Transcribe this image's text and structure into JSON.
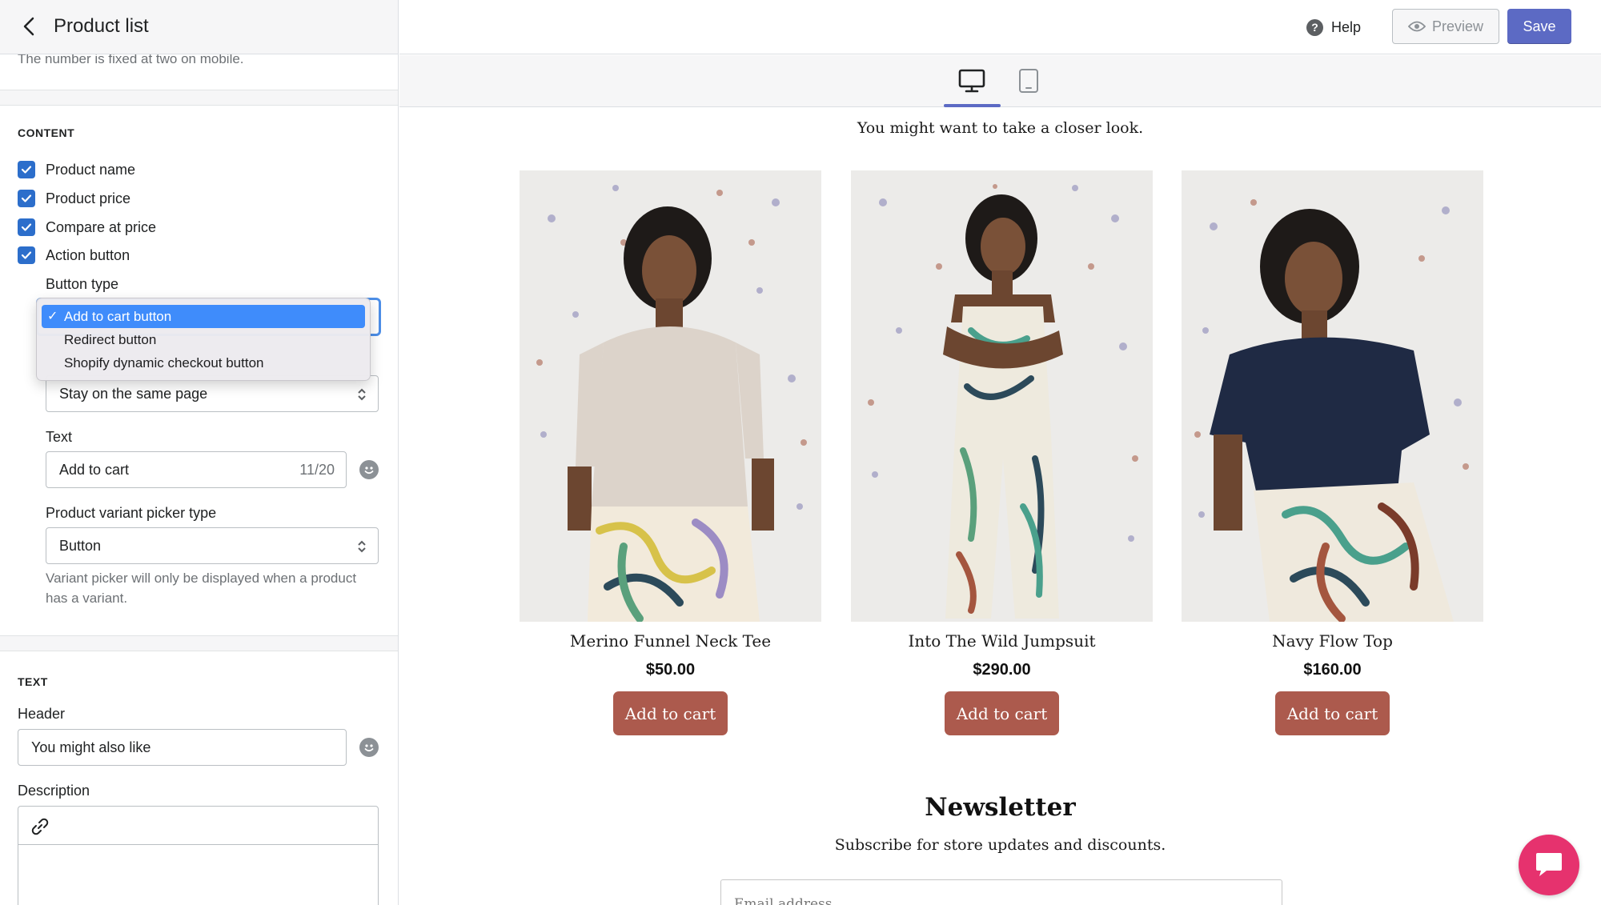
{
  "left_panel": {
    "title": "Product list",
    "top_help": "The number is fixed at two on mobile.",
    "content_section": {
      "title": "CONTENT",
      "checkboxes": [
        {
          "label": "Product name",
          "checked": true
        },
        {
          "label": "Product price",
          "checked": true
        },
        {
          "label": "Compare at price",
          "checked": true
        },
        {
          "label": "Action button",
          "checked": true
        }
      ],
      "button_type_label": "Button type",
      "button_type_options": [
        {
          "label": "Add to cart button",
          "selected": true
        },
        {
          "label": "Redirect button",
          "selected": false
        },
        {
          "label": "Shopify dynamic checkout button",
          "selected": false
        }
      ],
      "after_add_value": "Stay on the same page",
      "text_label": "Text",
      "text_value": "Add to cart",
      "text_counter": "11/20",
      "variant_label": "Product variant picker type",
      "variant_value": "Button",
      "variant_help": "Variant picker will only be displayed when a product has a variant."
    },
    "text_section": {
      "title": "TEXT",
      "header_label": "Header",
      "header_value": "You might also like",
      "description_label": "Description"
    }
  },
  "topbar": {
    "help_label": "Help",
    "preview_label": "Preview",
    "save_label": "Save",
    "devices": [
      "desktop-icon",
      "tablet-icon"
    ],
    "active_device": "desktop"
  },
  "preview": {
    "subtitle": "You might want to take a closer look.",
    "products": [
      {
        "name": "Merino Funnel Neck Tee",
        "price": "$50.00",
        "button": "Add to cart"
      },
      {
        "name": "Into The Wild Jumpsuit",
        "price": "$290.00",
        "button": "Add to cart"
      },
      {
        "name": "Navy Flow Top",
        "price": "$160.00",
        "button": "Add to cart"
      }
    ],
    "newsletter": {
      "title": "Newsletter",
      "subtitle": "Subscribe for store updates and discounts.",
      "email_placeholder": "Email address"
    }
  },
  "colors": {
    "accent": "#5c6ac4",
    "checkbox": "#2c6ecb",
    "add_to_cart": "#ac5a4d",
    "chat": "#e6326e",
    "dropdown_selected": "#3f8cfb"
  }
}
